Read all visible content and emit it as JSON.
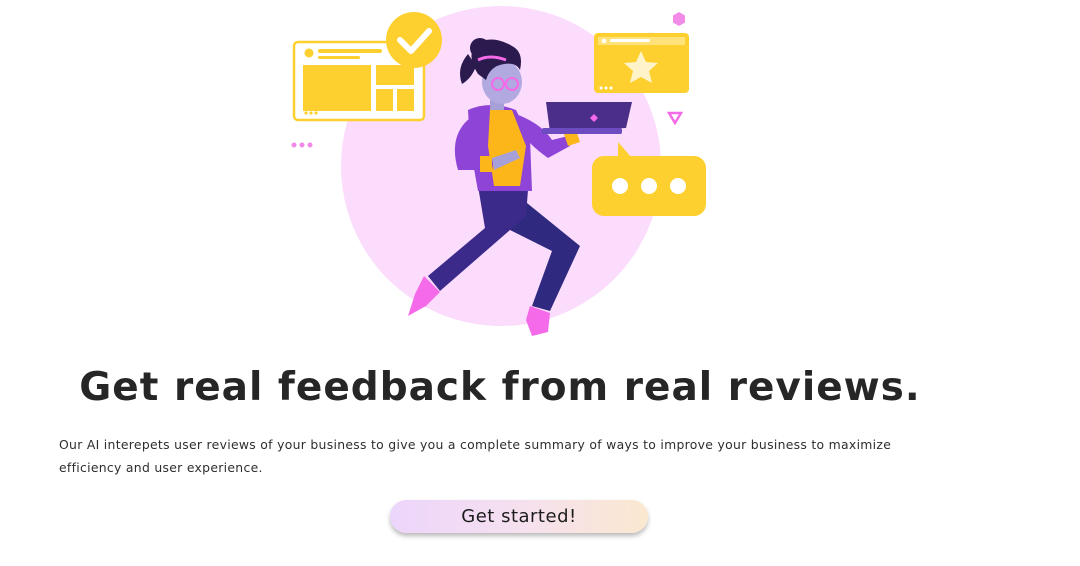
{
  "hero": {
    "illustration_icon": "person-with-laptop-feedback-illustration",
    "colors": {
      "yellow": "#fed02f",
      "pink_circle": "#fcdcfc",
      "purple": "#8e44d6",
      "navy": "#3b2a8a",
      "magenta": "#f56ae8"
    }
  },
  "headline": "Get real feedback from real reviews.",
  "description": "Our AI interepets user reviews of your business to give you a complete summary of ways to improve your business to maximize efficiency and user experience.",
  "cta": {
    "label": "Get started!"
  }
}
